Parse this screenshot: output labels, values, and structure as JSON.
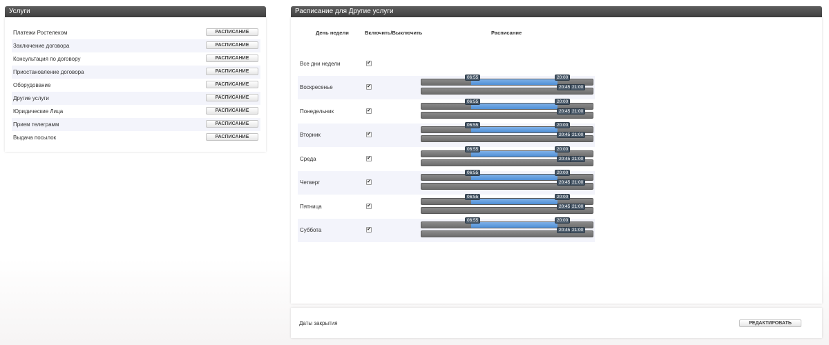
{
  "services": {
    "title": "Услуги",
    "button_label": "РАСПИСАНИЕ",
    "items": [
      "Платежи Ростелеком",
      "Заключение договора",
      "Консультация по договору",
      "Приостановление договора",
      "Оборудование",
      "Другие услуги",
      "Юридические Лица",
      "Прием телеграмм",
      "Выдача посылок"
    ]
  },
  "schedule": {
    "title": "Расписание для Другие услуги",
    "columns": {
      "day": "День недели",
      "toggle": "Включить/Выключить",
      "schedule": "Расписание"
    },
    "all_days_label": "Все дни недели",
    "range_start": "06:55",
    "range_end": "20:00",
    "break_start": "20:45",
    "break_end": "21:00",
    "days": [
      "Воскресенье",
      "Понедельник",
      "Вторник",
      "Среда",
      "Четверг",
      "Пятница",
      "Суббота"
    ]
  },
  "footer": {
    "label": "Даты закрытия",
    "edit_label": "РЕДАКТИРОВАТЬ"
  },
  "check_glyph": "✔",
  "colors": {
    "header_bg": "#4a4a4a",
    "range_fill": "#5b98dc",
    "track": "#7a7a7a",
    "row_alt": "#f3f4fb"
  }
}
